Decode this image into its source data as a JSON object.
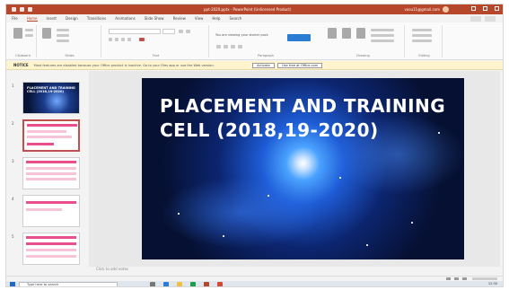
{
  "window": {
    "title": "ppt-2020.pptx - PowerPoint (Unlicensed Product)",
    "user": "vasu11@gmail.com"
  },
  "tabs": [
    "File",
    "Home",
    "Insert",
    "Design",
    "Transitions",
    "Animations",
    "Slide Show",
    "Review",
    "View",
    "Help",
    "Search"
  ],
  "ribbon": {
    "groups": [
      "Clipboard",
      "Slides",
      "Font",
      "Paragraph",
      "Drawing",
      "Editing"
    ],
    "hint": "You are viewing your starter pack"
  },
  "notice": {
    "label": "NOTICE",
    "message": "Most features are disabled because your Office product is inactive. Go to your Files app or use the Web version.",
    "btn_activate": "Activate",
    "btn_web": "Use free at Office.com"
  },
  "thumbnails": [
    {
      "number": "1",
      "title": "PLACEMENT AND TRAINING CELL (2018,19-2020)"
    },
    {
      "number": "2",
      "title": ""
    },
    {
      "number": "3",
      "title": ""
    },
    {
      "number": "4",
      "title": ""
    },
    {
      "number": "5",
      "title": ""
    }
  ],
  "slide": {
    "title": "PLACEMENT AND TRAINING\nCELL (2018,19-2020)"
  },
  "notes_placeholder": "Click to add notes",
  "taskbar": {
    "search_placeholder": "Type here to search",
    "time": "12:30"
  },
  "colors": {
    "accent": "#b7472a",
    "notice_bg": "#fff4ce",
    "thumb_pink": "#e84f8c"
  }
}
